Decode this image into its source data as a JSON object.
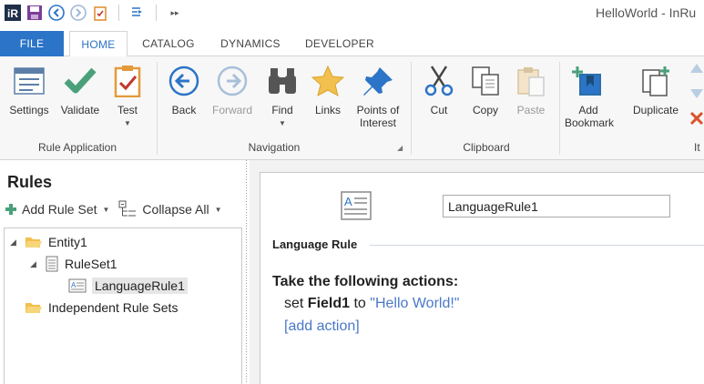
{
  "window": {
    "title": "HelloWorld - InRu"
  },
  "qat": {
    "logo_text": "iR"
  },
  "tabs": {
    "file": "FILE",
    "home": "HOME",
    "catalog": "CATALOG",
    "dynamics": "DYNAMICS",
    "developer": "DEVELOPER"
  },
  "ribbon": {
    "settings": "Settings",
    "validate": "Validate",
    "test": "Test",
    "back": "Back",
    "forward": "Forward",
    "find": "Find",
    "links": "Links",
    "poi_line1": "Points of",
    "poi_line2": "Interest",
    "cut": "Cut",
    "copy": "Copy",
    "paste": "Paste",
    "add_bookmark_line1": "Add",
    "add_bookmark_line2": "Bookmark",
    "duplicate": "Duplicate",
    "groups": {
      "rule_application": "Rule Application",
      "navigation": "Navigation",
      "clipboard": "Clipboard",
      "items_partial": "It"
    }
  },
  "left_panel": {
    "title": "Rules",
    "add_rule_set": "Add Rule Set",
    "collapse_all": "Collapse All",
    "tree": {
      "entity": "Entity1",
      "ruleset": "RuleSet1",
      "rule": "LanguageRule1",
      "independent": "Independent Rule Sets"
    }
  },
  "editor": {
    "rule_name": "LanguageRule1",
    "section_label": "Language Rule",
    "actions_heading": "Take the following actions:",
    "action_verb": "set",
    "action_field": "Field1",
    "action_to": "to",
    "action_value": "\"Hello World!\"",
    "add_action": "[add action]"
  },
  "colors": {
    "accent": "#2b74c7",
    "link": "#4a78c8",
    "folder": "#f2c04e",
    "check": "#4aa07a"
  }
}
